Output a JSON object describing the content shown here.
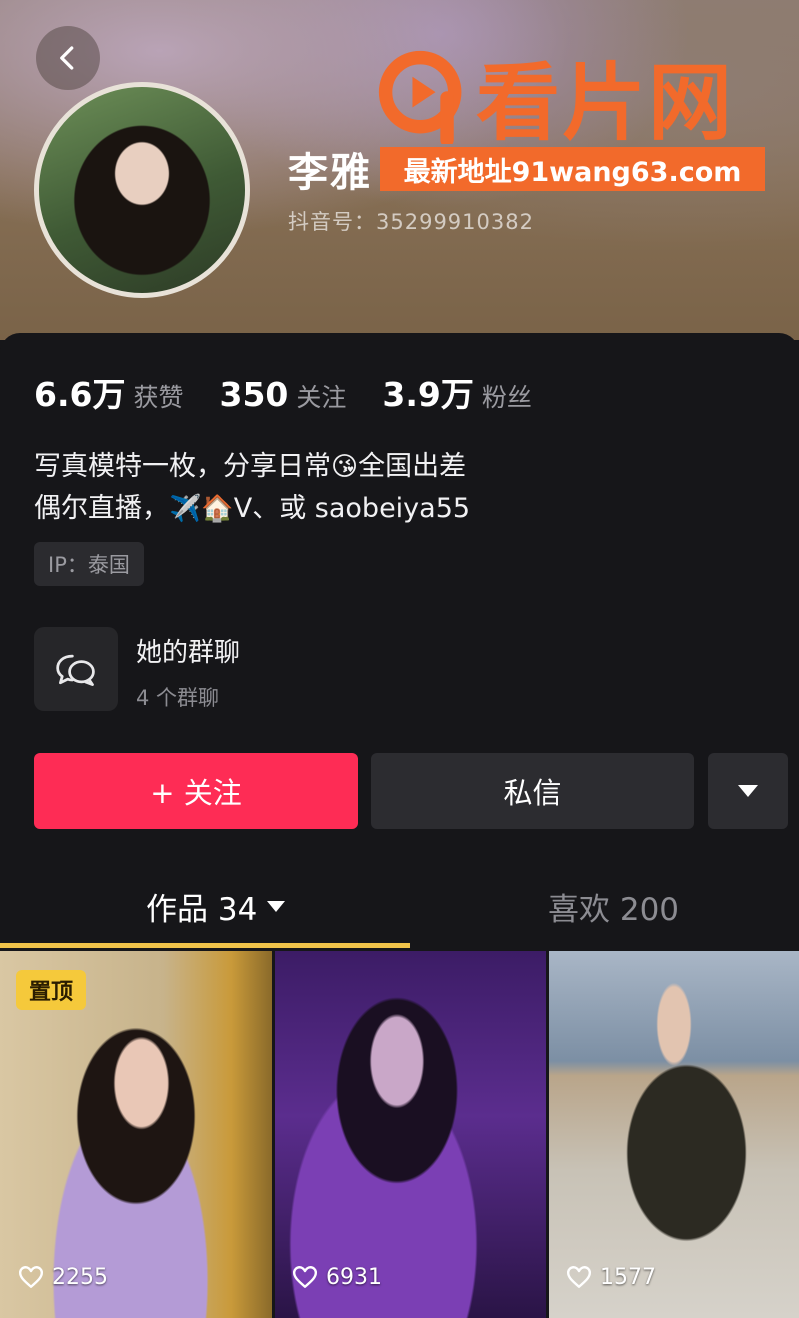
{
  "watermark": {
    "logo_text": "看片网",
    "url_text": "最新地址91wang63.com"
  },
  "profile": {
    "name": "李雅",
    "douyin_id": "抖音号：35299910382"
  },
  "stats": [
    {
      "value": "6.6万",
      "label": "获赞"
    },
    {
      "value": "350",
      "label": "关注"
    },
    {
      "value": "3.9万",
      "label": "粉丝"
    }
  ],
  "bio": {
    "line1_a": "写真模特一枚，分享日常",
    "line1_emoji": "😘",
    "line1_b": "全国出差",
    "line2_a": "偶尔直播，",
    "line2_emoji": "✈️🏠",
    "line2_b": "V、或 saobeiya55"
  },
  "ip_tag": "IP：泰国",
  "group_chat": {
    "title": "她的群聊",
    "subtitle": "4 个群聊"
  },
  "actions": {
    "follow": "+ 关注",
    "message": "私信"
  },
  "tabs": {
    "works": "作品 34",
    "likes": "喜欢 200"
  },
  "videos": [
    {
      "likes": "2255",
      "pinned_label": "置顶"
    },
    {
      "likes": "6931"
    },
    {
      "likes": "1577"
    }
  ],
  "colors": {
    "follow_button": "#fe2c55",
    "tab_indicator": "#f0c34a",
    "pin_badge": "#f5c93b",
    "watermark": "#f26a2b"
  }
}
